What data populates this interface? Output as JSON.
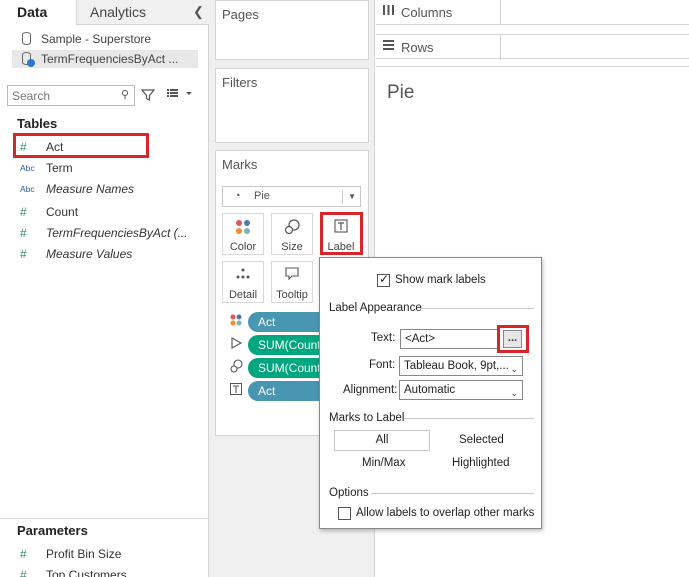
{
  "data_pane": {
    "tabs": {
      "data": "Data",
      "analytics": "Analytics"
    },
    "collapse_icon": "chevron-left-icon",
    "datasources": [
      {
        "name": "Sample - Superstore",
        "icon": "database-icon"
      },
      {
        "name": "TermFrequenciesByAct ...",
        "icon": "database-check-icon"
      }
    ],
    "search": {
      "placeholder": "Search"
    },
    "tables_title": "Tables",
    "fields": [
      {
        "name": "Act",
        "type_icon": "#"
      },
      {
        "name": "Term",
        "type_icon": "Abc"
      },
      {
        "name": "Measure Names",
        "type_icon": "Abc"
      },
      {
        "name": "Count",
        "type_icon": "#"
      },
      {
        "name": "TermFrequenciesByAct (...",
        "type_icon": "#"
      },
      {
        "name": "Measure Values",
        "type_icon": "#"
      }
    ],
    "parameters_title": "Parameters",
    "parameters": [
      {
        "name": "Profit Bin Size",
        "type_icon": "#"
      },
      {
        "name": "Top Customers",
        "type_icon": "#"
      }
    ]
  },
  "shelves": {
    "pages": "Pages",
    "filters": "Filters",
    "marks": "Marks",
    "columns": "Columns",
    "rows": "Rows"
  },
  "marks_card": {
    "mark_type": "Pie",
    "buttons": {
      "color": "Color",
      "size": "Size",
      "label": "Label",
      "detail": "Detail",
      "tooltip": "Tooltip"
    },
    "pills": [
      {
        "text": "Act",
        "encoding": "color"
      },
      {
        "text": "SUM(Count)",
        "encoding": "angle"
      },
      {
        "text": "SUM(Count)",
        "encoding": "size"
      },
      {
        "text": "Act",
        "encoding": "label"
      }
    ]
  },
  "view": {
    "title": "Pie"
  },
  "label_popup": {
    "show_mark_labels": "Show mark labels",
    "show_mark_labels_checked": true,
    "label_appearance": "Label Appearance",
    "text_label": "Text:",
    "text_value": "<Act>",
    "ellipsis": "...",
    "font_label": "Font:",
    "font_value": "Tableau Book, 9pt,...",
    "alignment_label": "Alignment:",
    "alignment_value": "Automatic",
    "marks_to_label": "Marks to Label",
    "options_marks": [
      "All",
      "Selected",
      "Min/Max",
      "Highlighted"
    ],
    "options_title": "Options",
    "allow_overlap": "Allow labels to overlap other marks",
    "allow_overlap_checked": false
  },
  "annotation_color": "#d7262a"
}
